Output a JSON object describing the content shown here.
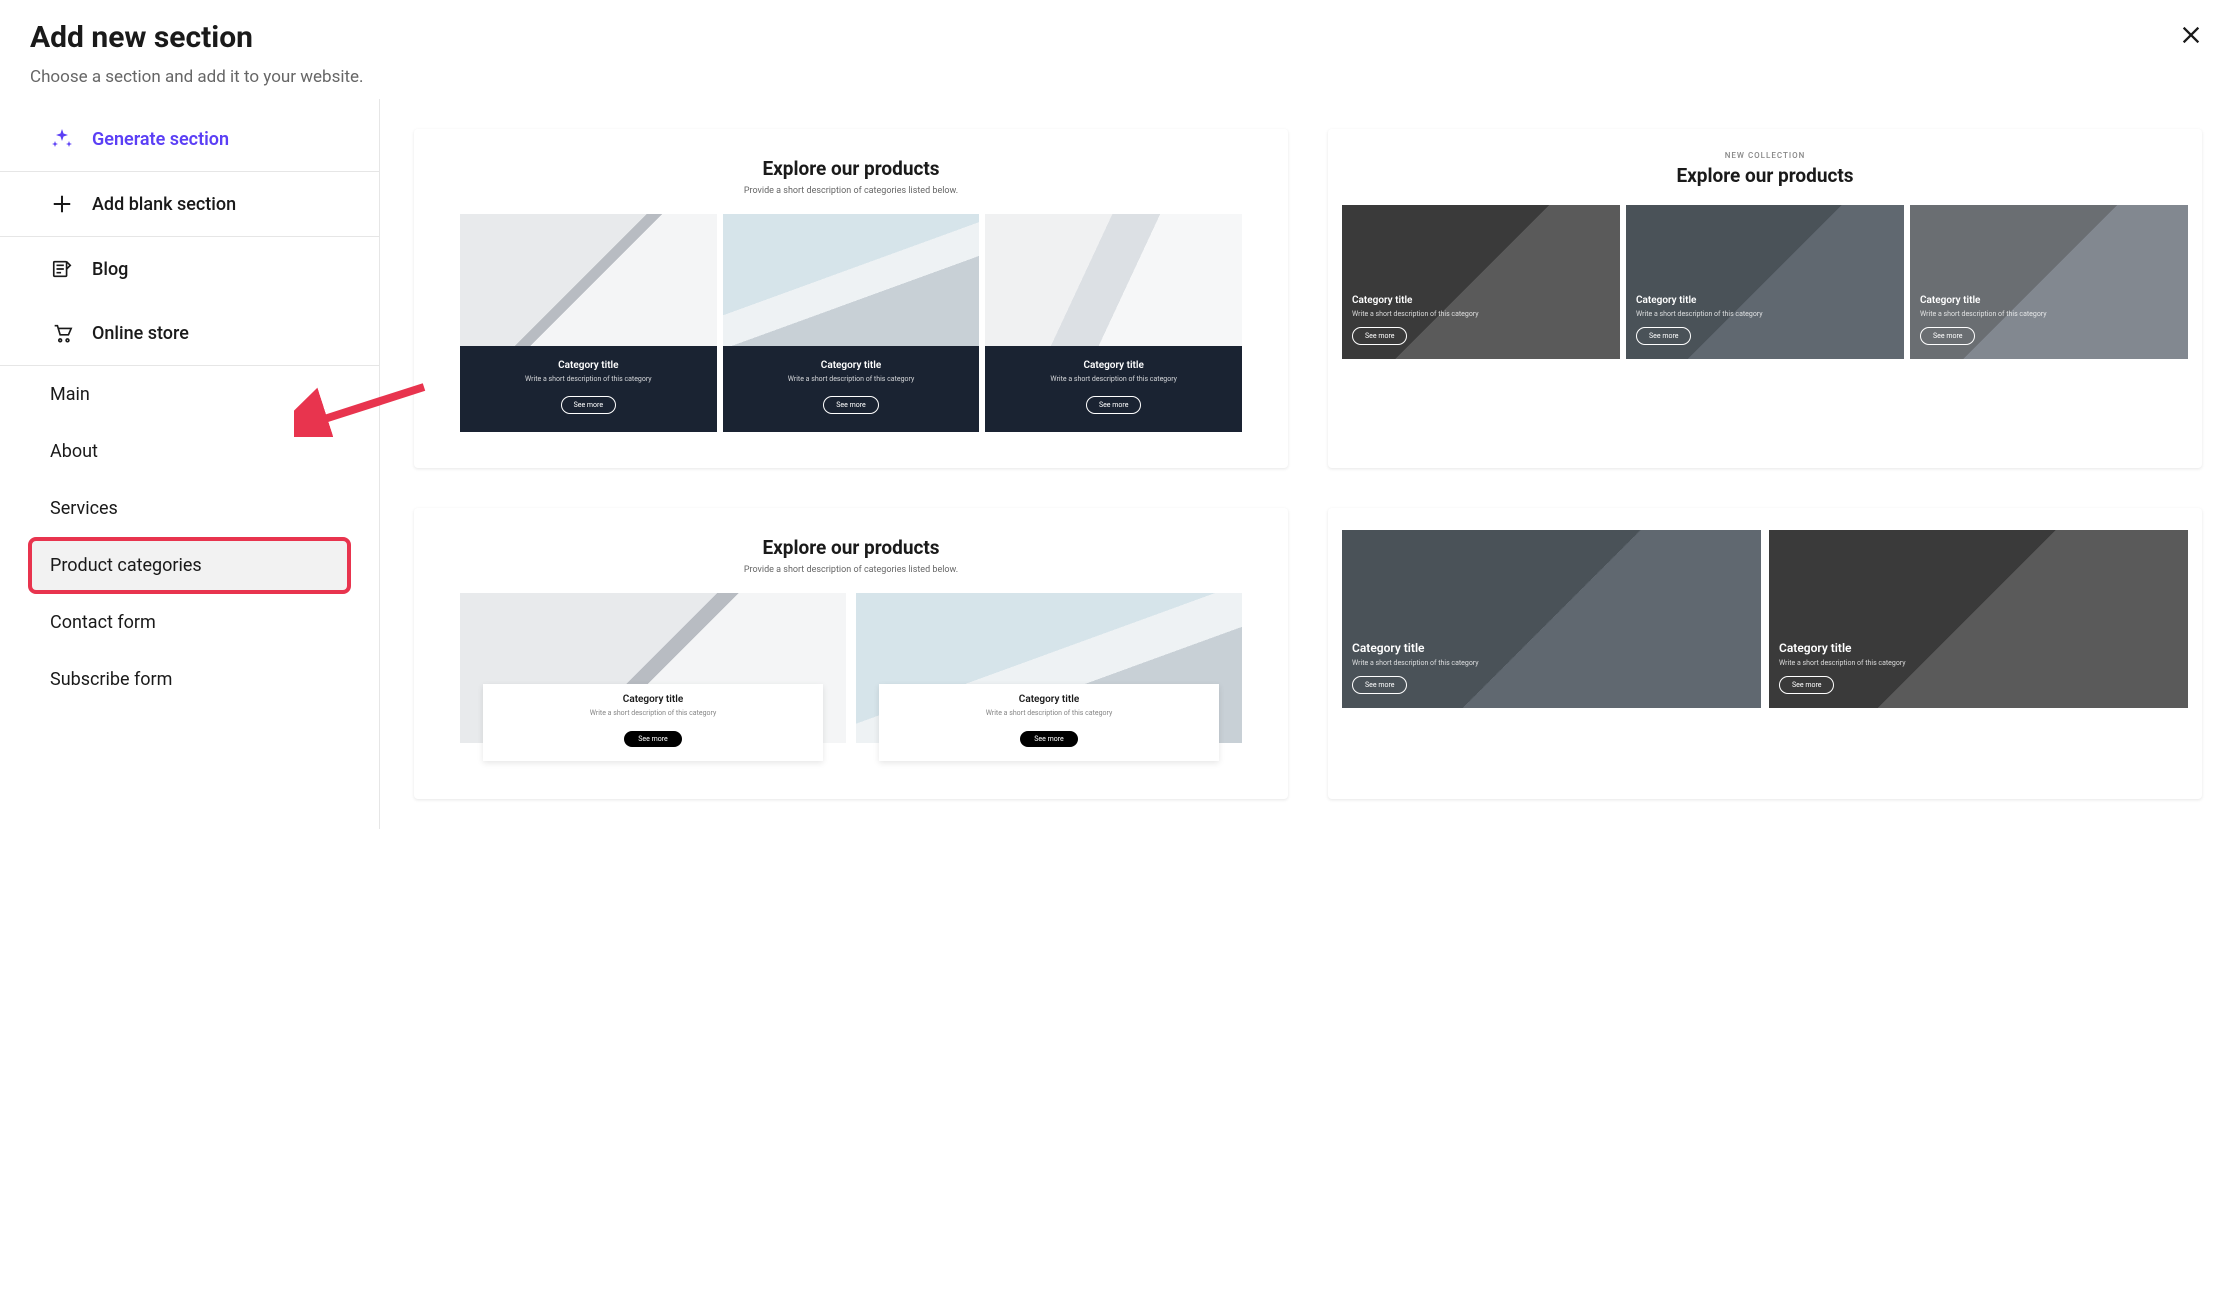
{
  "header": {
    "title": "Add new section",
    "subtitle": "Choose a section and add it to your website."
  },
  "sidebar": {
    "generate": "Generate section",
    "blank": "Add blank section",
    "blog": "Blog",
    "store": "Online store",
    "nav": {
      "main": "Main",
      "about": "About",
      "services": "Services",
      "product_categories": "Product categories",
      "contact": "Contact form",
      "subscribe": "Subscribe form"
    }
  },
  "templates": {
    "t1": {
      "title": "Explore our products",
      "sub": "Provide a short description of categories listed below.",
      "cat_title": "Category title",
      "cat_desc": "Write a short description of this category",
      "btn": "See more"
    },
    "t2": {
      "eyebrow": "NEW COLLECTION",
      "title": "Explore our products",
      "cat_title": "Category title",
      "cat_desc": "Write a short description of this category",
      "btn": "See more"
    },
    "t3": {
      "title": "Explore our products",
      "sub": "Provide a short description of categories listed below.",
      "cat_title": "Category title",
      "cat_desc": "Write a short description of this category",
      "btn": "See more"
    },
    "t4": {
      "cat_title": "Category title",
      "cat_desc": "Write a short description of this category",
      "btn": "See more"
    }
  },
  "colors": {
    "accent": "#5b3ff5",
    "highlight": "#e8344e"
  }
}
